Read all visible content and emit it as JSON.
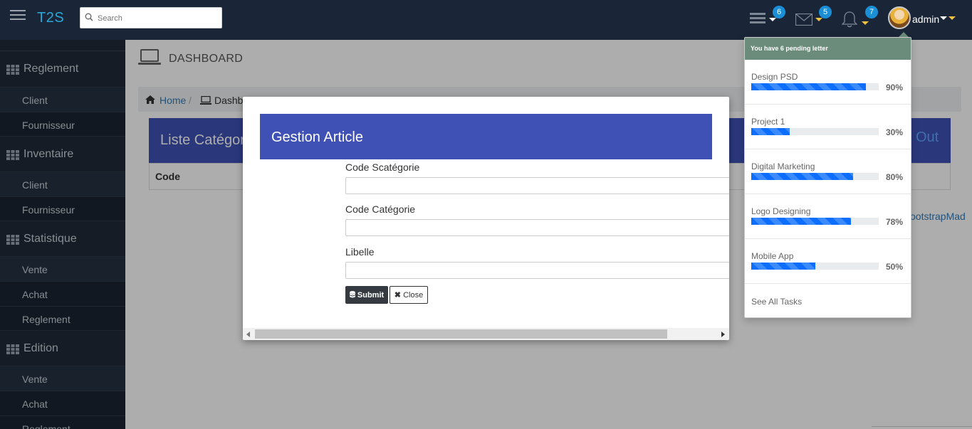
{
  "header": {
    "logo": "T2S",
    "search_placeholder": "Search",
    "badges": {
      "tasks": "6",
      "mail": "5",
      "notifications": "7"
    },
    "user": "admin"
  },
  "sidebar": {
    "sections": [
      {
        "label": "Reglement",
        "items": [
          "Client",
          "Fournisseur"
        ]
      },
      {
        "label": "Inventaire",
        "items": [
          "Client",
          "Fournisseur"
        ]
      },
      {
        "label": "Statistique",
        "items": [
          "Vente",
          "Achat",
          "Reglement"
        ]
      },
      {
        "label": "Edition",
        "items": [
          "Vente",
          "Achat",
          "Reglement"
        ]
      }
    ]
  },
  "page": {
    "title": "DASHBOARD",
    "breadcrumb": {
      "home": "Home",
      "separator": "/",
      "current": "Dashb"
    },
    "panel_title": "Liste Catégor",
    "panel_right": "Out",
    "column_code": "Code",
    "footer_link": "ootstrapMad"
  },
  "modal": {
    "title": "Gestion Article",
    "fields": [
      {
        "label": "Code Scatégorie",
        "value": ""
      },
      {
        "label": "Code Catégorie",
        "value": ""
      },
      {
        "label": "Libelle",
        "value": ""
      }
    ],
    "submit_label": "Submit",
    "close_label": "Close"
  },
  "tasks_dropdown": {
    "header": "You have 6 pending letter",
    "tasks": [
      {
        "name": "Design PSD",
        "percent": "90%",
        "progress": 90
      },
      {
        "name": "Project 1",
        "percent": "30%",
        "progress": 30
      },
      {
        "name": "Digital Marketing",
        "percent": "80%",
        "progress": 80
      },
      {
        "name": "Logo Designing",
        "percent": "78%",
        "progress": 78
      },
      {
        "name": "Mobile App",
        "percent": "50%",
        "progress": 50
      }
    ],
    "footer": "See All Tasks"
  },
  "colors": {
    "topbar": "#1b2538",
    "sidebar": "#1f2a39",
    "panel_accent": "#3f51b5",
    "dropdown_header": "#6b8c7a",
    "badge": "#1a8fd6",
    "progress": "#0d6efd"
  }
}
